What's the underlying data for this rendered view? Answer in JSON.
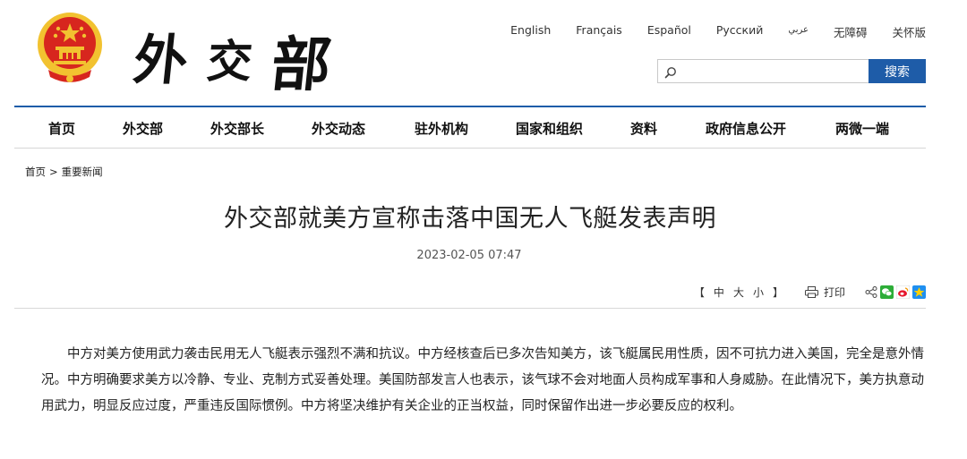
{
  "header": {
    "site_name_chars": [
      "外",
      "交",
      "部"
    ],
    "languages": [
      {
        "label": "English",
        "small": false
      },
      {
        "label": "Français",
        "small": false
      },
      {
        "label": "Español",
        "small": false
      },
      {
        "label": "Русский",
        "small": false
      },
      {
        "label": "عربي",
        "small": true
      },
      {
        "label": "无障碍",
        "small": false
      },
      {
        "label": "关怀版",
        "small": false
      }
    ],
    "search": {
      "placeholder": "",
      "button_label": "搜索"
    }
  },
  "nav": {
    "items": [
      "首页",
      "外交部",
      "外交部长",
      "外交动态",
      "驻外机构",
      "国家和组织",
      "资料",
      "政府信息公开",
      "两微一端"
    ]
  },
  "breadcrumb": {
    "home": "首页",
    "separator": ">",
    "current": "重要新闻"
  },
  "article": {
    "title": "外交部就美方宣称击落中国无人飞艇发表声明",
    "date": "2023-02-05 07:47",
    "toolbar": {
      "bracket_open": "【",
      "size_small": "中",
      "size_large": "大",
      "size_smaller": "小",
      "bracket_close": "】",
      "print_label": "打印"
    },
    "body": "中方对美方使用武力袭击民用无人飞艇表示强烈不满和抗议。中方经核查后已多次告知美方，该飞艇属民用性质，因不可抗力进入美国，完全是意外情况。中方明确要求美方以冷静、专业、克制方式妥善处理。美国防部发言人也表示，该气球不会对地面人员构成军事和人身威胁。在此情况下，美方执意动用武力，明显反应过度，严重违反国际惯例。中方将坚决维护有关企业的正当权益，同时保留作出进一步必要反应的权利。"
  },
  "colors": {
    "accent": "#1e5ca8",
    "emblem_red": "#d7261e",
    "emblem_gold": "#f2c230"
  }
}
